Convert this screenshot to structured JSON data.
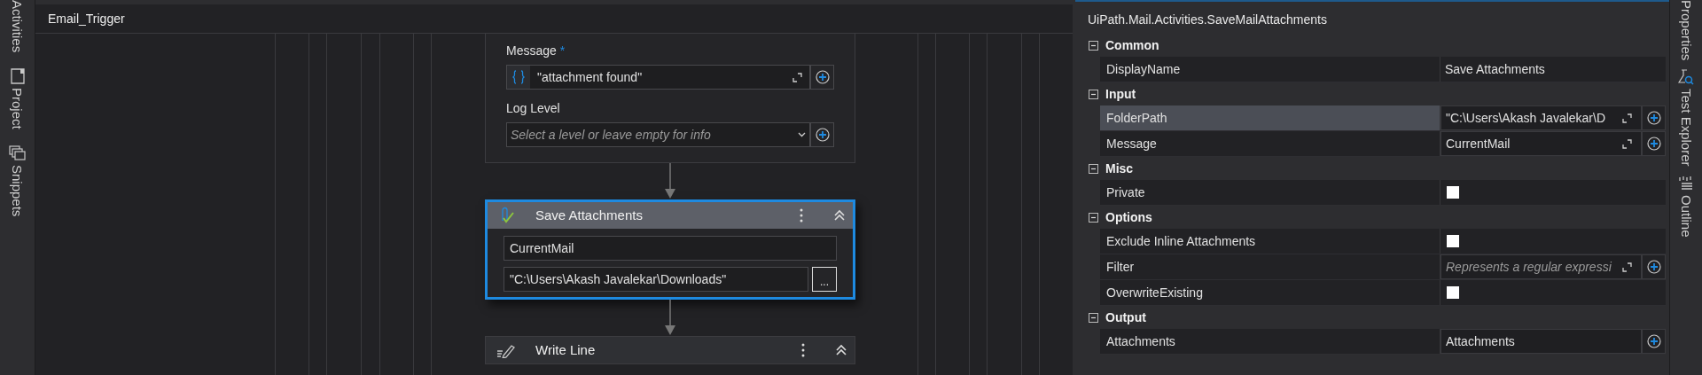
{
  "left_tabs": [
    {
      "label": "Activities",
      "kind": "activities"
    },
    {
      "label": "Project",
      "kind": "project"
    },
    {
      "label": "Snippets",
      "kind": "snippets"
    }
  ],
  "designer": {
    "tab_title": "Email_Trigger",
    "log_card": {
      "fields": [
        {
          "kind": "expression",
          "label": "Message",
          "marker": "*",
          "value": "\"attachment found\""
        },
        {
          "kind": "dropdown",
          "label": "Log Level",
          "placeholder": "Select a level or leave empty for info"
        }
      ]
    },
    "activities": [
      {
        "kind": "save_attachments",
        "title": "Save Attachments",
        "selected": true,
        "inputs": [
          {
            "value": "CurrentMail"
          },
          {
            "value": "\"C:\\Users\\Akash Javalekar\\Downloads\"",
            "browse": "..."
          }
        ]
      },
      {
        "kind": "write_line",
        "title": "Write Line",
        "selected": false
      }
    ]
  },
  "properties": {
    "title": "UiPath.Mail.Activities.SaveMailAttachments",
    "sections": [
      {
        "name": "Common",
        "expanded": true,
        "rows": [
          {
            "label": "DisplayName",
            "kind": "text",
            "selected": false,
            "value": "Save Attachments"
          }
        ]
      },
      {
        "name": "Input",
        "expanded": true,
        "rows": [
          {
            "label": "FolderPath",
            "kind": "expression",
            "selected": true,
            "value": "\"C:\\Users\\Akash Javalekar\\D"
          },
          {
            "label": "Message",
            "kind": "expression",
            "selected": false,
            "value": "CurrentMail"
          }
        ]
      },
      {
        "name": "Misc",
        "expanded": true,
        "rows": [
          {
            "label": "Private",
            "kind": "checkbox",
            "selected": false,
            "checked": false
          }
        ]
      },
      {
        "name": "Options",
        "expanded": true,
        "rows": [
          {
            "label": "Exclude Inline Attachments",
            "kind": "checkbox",
            "selected": false,
            "checked": false
          },
          {
            "label": "Filter",
            "kind": "expression",
            "selected": false,
            "placeholder": "Represents a regular expressi"
          },
          {
            "label": "OverwriteExisting",
            "kind": "checkbox",
            "selected": false,
            "checked": false
          }
        ]
      },
      {
        "name": "Output",
        "expanded": true,
        "rows": [
          {
            "label": "Attachments",
            "kind": "output",
            "selected": false,
            "value": "Attachments"
          }
        ]
      }
    ]
  },
  "right_tabs": [
    {
      "label": "Properties",
      "kind": "properties"
    },
    {
      "label": "Test Explorer",
      "kind": "test_explorer"
    },
    {
      "label": "Outline",
      "kind": "outline"
    }
  ]
}
